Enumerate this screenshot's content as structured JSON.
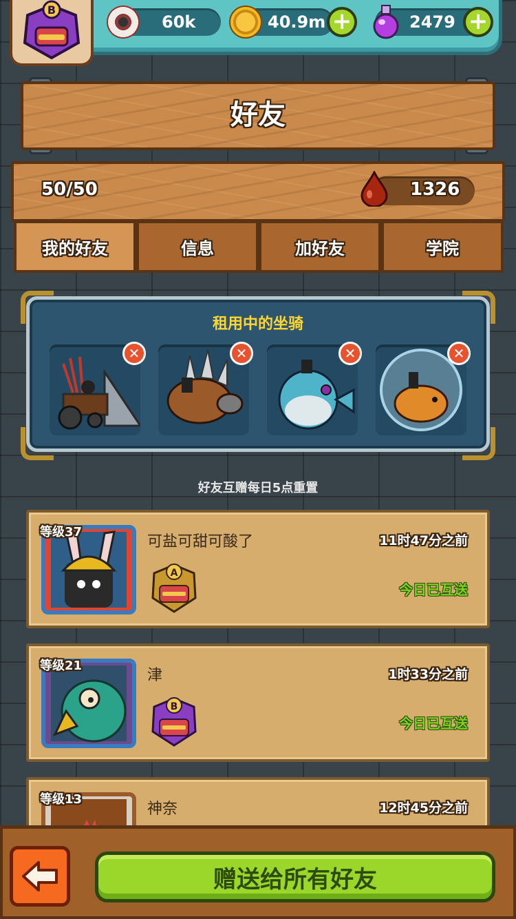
{
  "player": {
    "rank_badge": "B"
  },
  "resources": {
    "eyes": {
      "icon": "eyeball-icon",
      "value": "60k"
    },
    "coins": {
      "icon": "coin-icon",
      "value": "40.9m"
    },
    "potions": {
      "icon": "potion-icon",
      "value": "2479"
    }
  },
  "header": {
    "title": "好友"
  },
  "stats": {
    "friend_count": "50/50",
    "blood_value": "1326"
  },
  "tabs": [
    {
      "label": "我的好友",
      "active": true
    },
    {
      "label": "信息",
      "active": false
    },
    {
      "label": "加好友",
      "active": false
    },
    {
      "label": "学院",
      "active": false
    }
  ],
  "mounts": {
    "title": "租用中的坐骑",
    "items": [
      {
        "icon": "spiked-cart-mount-icon"
      },
      {
        "icon": "armored-boar-mount-icon"
      },
      {
        "icon": "pufferfish-mount-icon"
      },
      {
        "icon": "hamster-ball-mount-icon"
      }
    ]
  },
  "reset_note": "好友互赠每日5点重置",
  "friends": [
    {
      "level": "等级37",
      "name": "可盐可甜可酸了",
      "time": "11时47分之前",
      "badge": "A",
      "status": "今日已互送"
    },
    {
      "level": "等级21",
      "name": "津",
      "time": "1时33分之前",
      "badge": "B",
      "status": "今日已互送"
    },
    {
      "level": "等级13",
      "name": "神奈",
      "time": "12时45分之前"
    }
  ],
  "footer": {
    "gift_all_label": "赠送给所有好友"
  },
  "colors": {
    "accent_green": "#9bd62b",
    "status_green": "#7ed321",
    "mount_title": "#ffd630",
    "back_orange": "#f56a1f"
  }
}
